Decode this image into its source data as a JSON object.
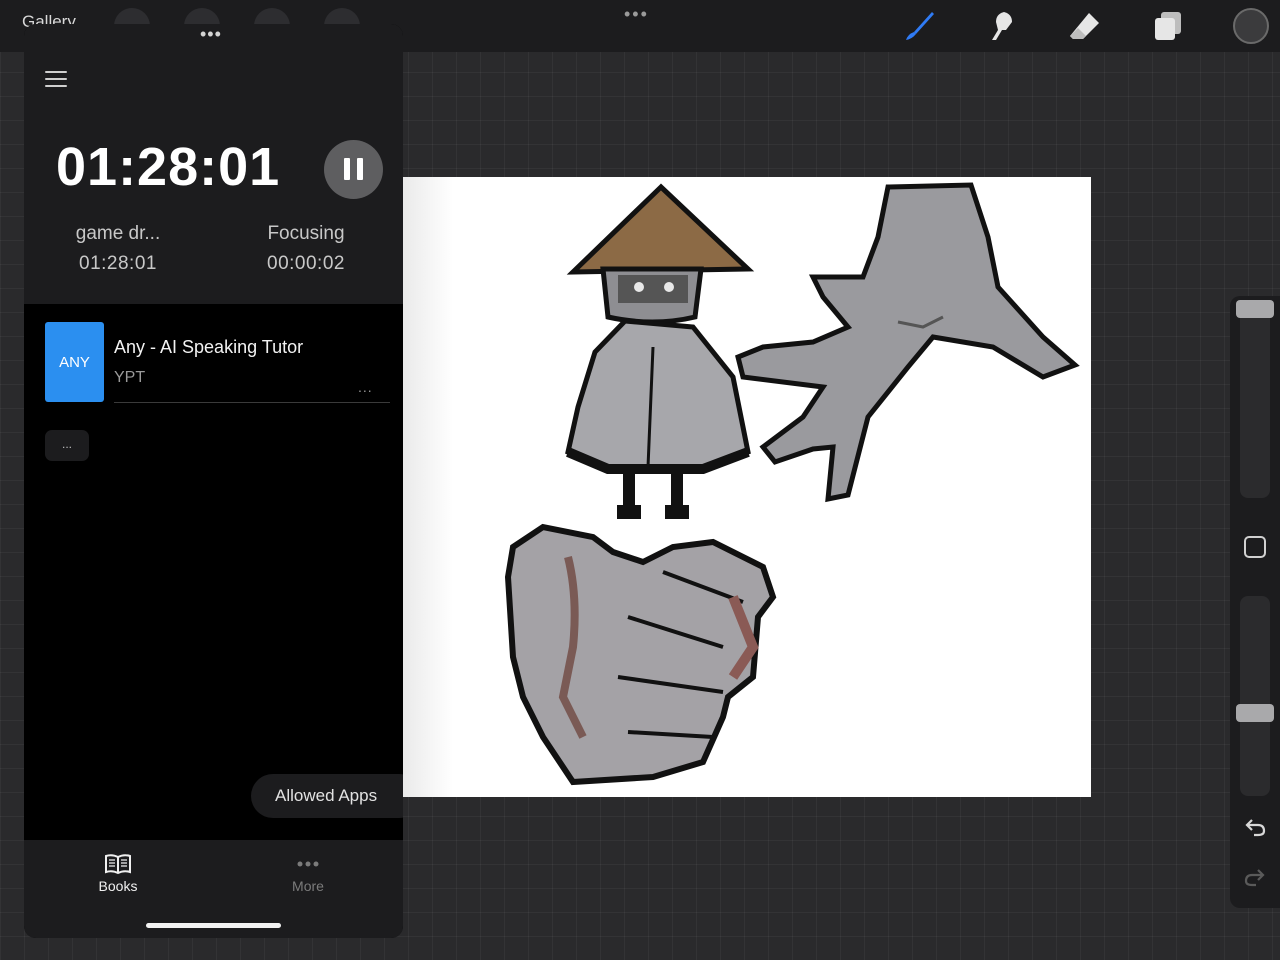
{
  "topbar": {
    "gallery_label": "Gallery",
    "center_menu": "•••",
    "tools": [
      "brush-icon",
      "smudge-icon",
      "eraser-icon",
      "layers-icon",
      "color-swatch"
    ],
    "accent_color": "#2f7bf5"
  },
  "panel": {
    "grab_handle": "•••",
    "menu_icon": "hamburger-icon",
    "timer": "01:28:01",
    "pause_icon": "pause-icon",
    "task": {
      "label": "game dr...",
      "time": "01:28:01"
    },
    "focusing": {
      "label": "Focusing",
      "time": "00:00:02"
    },
    "app": {
      "icon_text": "ANY",
      "icon_color": "#2b8ff0",
      "title": "Any - AI Speaking Tutor",
      "subtitle": "YPT",
      "more": "..."
    },
    "small_more": "...",
    "allowed_apps": "Allowed Apps",
    "tabs": [
      {
        "label": "Books",
        "icon": "book-icon",
        "active": true
      },
      {
        "label": "More",
        "icon": "more-dots-icon",
        "active": false
      }
    ]
  },
  "sidebar": {
    "icons": [
      "modify-square-icon",
      "undo-icon",
      "redo-icon"
    ]
  }
}
